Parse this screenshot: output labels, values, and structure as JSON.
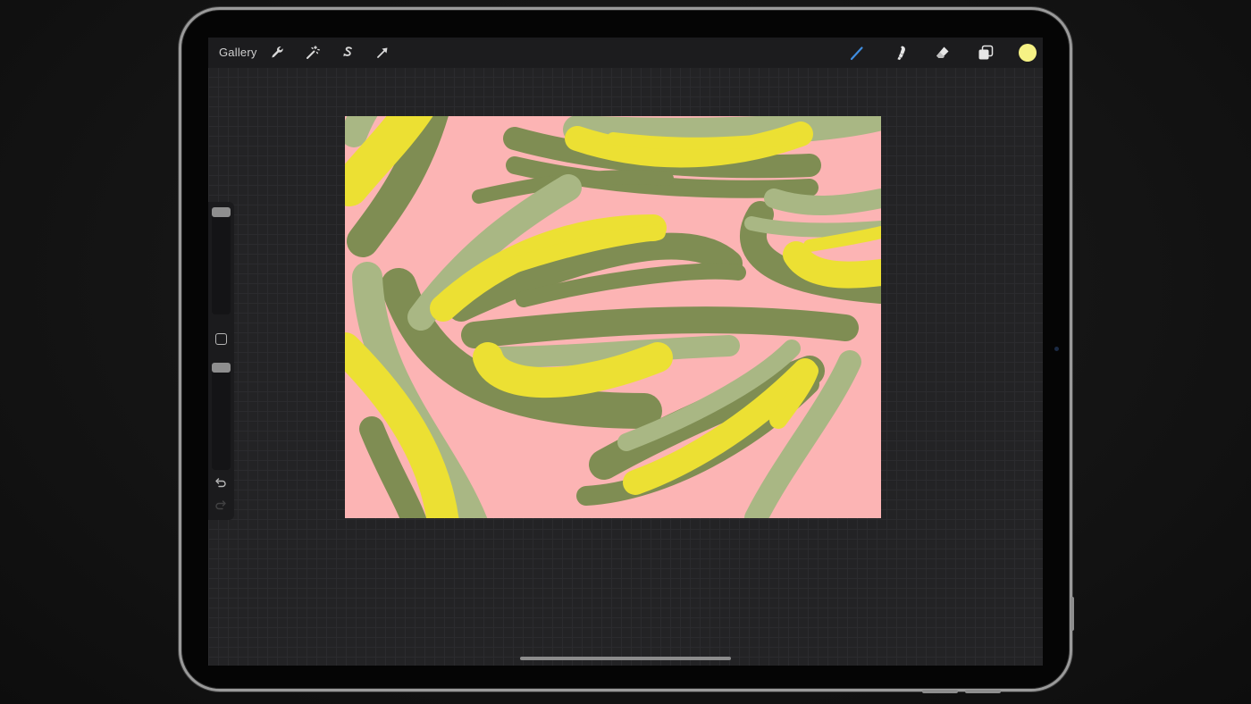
{
  "toolbar": {
    "gallery_label": "Gallery",
    "left_tools": [
      {
        "name": "actions",
        "icon": "wrench-icon"
      },
      {
        "name": "adjustments",
        "icon": "magic-wand-icon"
      },
      {
        "name": "selection",
        "icon": "selection-s-icon"
      },
      {
        "name": "transform",
        "icon": "arrow-cursor-icon"
      }
    ],
    "right_tools": [
      {
        "name": "brush",
        "icon": "brush-icon",
        "active": true
      },
      {
        "name": "smudge",
        "icon": "smudge-finger-icon"
      },
      {
        "name": "eraser",
        "icon": "eraser-icon"
      },
      {
        "name": "layers",
        "icon": "layers-icon"
      }
    ],
    "current_color": "#f6f285",
    "active_tool_color": "#3f8de0"
  },
  "sidebar": {
    "brush_size": 0.0,
    "brush_opacity": 0.0,
    "modify_icon": "square-outline-icon",
    "undo_icon": "undo-arrow-icon",
    "redo_icon": "redo-arrow-icon"
  },
  "canvas": {
    "background_color": "#fcb4b4",
    "palette": {
      "dark_green": "#7f8d53",
      "light_green": "#a9b784",
      "yellow": "#ece033"
    }
  }
}
